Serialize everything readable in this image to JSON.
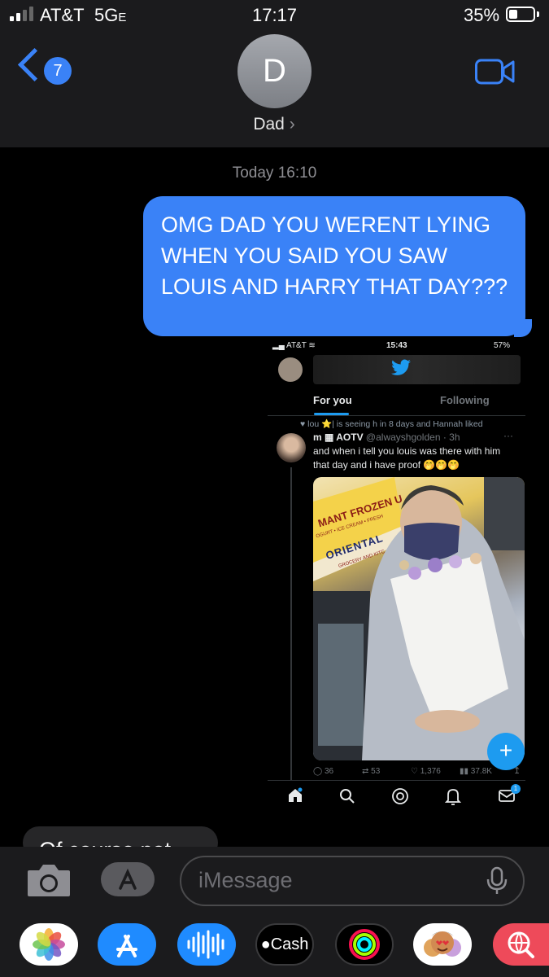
{
  "status_bar": {
    "carrier": "AT&T",
    "network": "5G",
    "network_suffix": "E",
    "time": "17:17",
    "battery": "35%",
    "signal_bars": 2,
    "battery_level": 0.35
  },
  "header": {
    "back_count": "7",
    "avatar_letter": "D",
    "contact_name": "Dad",
    "contact_chevron": "›"
  },
  "thread": {
    "timestamp": "Today 16:10",
    "message": "OMG DAD YOU WERENT LYING WHEN YOU SAID YOU SAW LOUIS AND HARRY THAT DAY???",
    "peek_text": "Of course not"
  },
  "screenshot": {
    "carrier": "AT&T",
    "time": "15:43",
    "battery": "57%",
    "tab_for_you": "For you",
    "tab_following": "Following",
    "liked_line": "lou ⭐️| is seeing h in 8 days and Hannah liked",
    "author_prefix": "m",
    "author_name": "AOTV",
    "handle": "@alwayshgolden · 3h",
    "more": "···",
    "tweet_text_1": "and when i tell you louis was there with him",
    "tweet_text_2": "that day and i have proof 🤭🤭🤭",
    "sign_top": "MANT FROZEN U",
    "sign_sub": "OGURT • ICE CREAM • FRESH",
    "sign_main": "ORIENTAL",
    "sign_small": "GROCERY AND KITC",
    "fab": "+",
    "replies": "36",
    "retweets": "53",
    "likes": "1,376",
    "views": "37.8K",
    "notif_badge": "1"
  },
  "compose": {
    "placeholder": "iMessage"
  },
  "tray": {
    "cash_label": "Cash"
  },
  "colors": {
    "imessage_blue": "#3a82f7",
    "twitter_blue": "#1d9bf0",
    "background": "#000000",
    "bar": "#1b1b1d"
  }
}
